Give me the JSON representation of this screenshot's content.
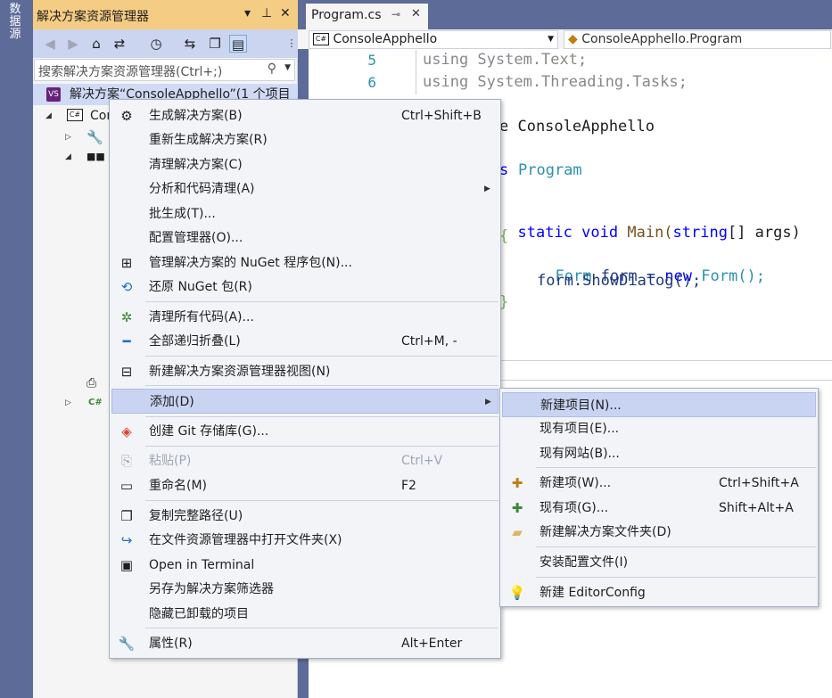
{
  "side_strip": {
    "label": "数据源"
  },
  "solution_explorer": {
    "title": "解决方案资源管理器",
    "pin_glyph": "⊢",
    "close_glyph": "✕",
    "menu_glyph": "▾",
    "search_placeholder": "搜索解决方案资源管理器(Ctrl+;)",
    "tree": {
      "solution_label": "解决方案“ConsoleApphello”(1 个项目",
      "project_label": "Con"
    }
  },
  "editor": {
    "tab_label": "Program.cs",
    "tab_pin": "⊸",
    "tab_close": "✕",
    "nav_project": "ConsoleApphello",
    "nav_class": "ConsoleApphello.Program",
    "lines": [
      {
        "num": "5",
        "text": "using System.Text;"
      },
      {
        "num": "6",
        "text": "using System.Threading.Tasks;"
      }
    ],
    "code": {
      "namespace_tail": "e ConsoleApphello",
      "class_kw": "s",
      "class_name": "Program",
      "main_sig_static": "static",
      "main_sig_void": "void",
      "main_sig_name": "Main(",
      "main_sig_string": "string",
      "main_sig_rest": "[] args)",
      "open_brace": "{",
      "form_line_type": "Form",
      "form_line_rest1": " form = ",
      "form_line_new": "new",
      "form_line_rest2": " Form();",
      "show_line": "form.ShowDialog();",
      "close_brace": "}"
    }
  },
  "context_menu": {
    "items": [
      {
        "label": "生成解决方案(B)",
        "shortcut": "Ctrl+Shift+B"
      },
      {
        "label": "重新生成解决方案(R)",
        "shortcut": ""
      },
      {
        "label": "清理解决方案(C)",
        "shortcut": ""
      },
      {
        "label": "分析和代码清理(A)",
        "shortcut": ""
      },
      {
        "label": "批生成(T)...",
        "shortcut": ""
      },
      {
        "label": "配置管理器(O)...",
        "shortcut": ""
      },
      {
        "label": "管理解决方案的 NuGet 程序包(N)...",
        "shortcut": ""
      },
      {
        "label": "还原 NuGet 包(R)",
        "shortcut": ""
      },
      {
        "label": "清理所有代码(A)...",
        "shortcut": ""
      },
      {
        "label": "全部递归折叠(L)",
        "shortcut": "Ctrl+M, -"
      },
      {
        "label": "新建解决方案资源管理器视图(N)",
        "shortcut": ""
      },
      {
        "label": "添加(D)",
        "shortcut": ""
      },
      {
        "label": "创建 Git 存储库(G)...",
        "shortcut": ""
      },
      {
        "label": "粘贴(P)",
        "shortcut": "Ctrl+V"
      },
      {
        "label": "重命名(M)",
        "shortcut": "F2"
      },
      {
        "label": "复制完整路径(U)",
        "shortcut": ""
      },
      {
        "label": "在文件资源管理器中打开文件夹(X)",
        "shortcut": ""
      },
      {
        "label": "Open in Terminal",
        "shortcut": ""
      },
      {
        "label": "另存为解决方案筛选器",
        "shortcut": ""
      },
      {
        "label": "隐藏已卸载的项目",
        "shortcut": ""
      },
      {
        "label": "属性(R)",
        "shortcut": "Alt+Enter"
      }
    ]
  },
  "submenu": {
    "items": [
      {
        "label": "新建项目(N)...",
        "shortcut": ""
      },
      {
        "label": "现有项目(E)...",
        "shortcut": ""
      },
      {
        "label": "现有网站(B)...",
        "shortcut": ""
      },
      {
        "label": "新建项(W)...",
        "shortcut": "Ctrl+Shift+A"
      },
      {
        "label": "现有项(G)...",
        "shortcut": "Shift+Alt+A"
      },
      {
        "label": "新建解决方案文件夹(D)",
        "shortcut": ""
      },
      {
        "label": "安装配置文件(I)",
        "shortcut": ""
      },
      {
        "label": "新建 EditorConfig",
        "shortcut": ""
      }
    ]
  }
}
